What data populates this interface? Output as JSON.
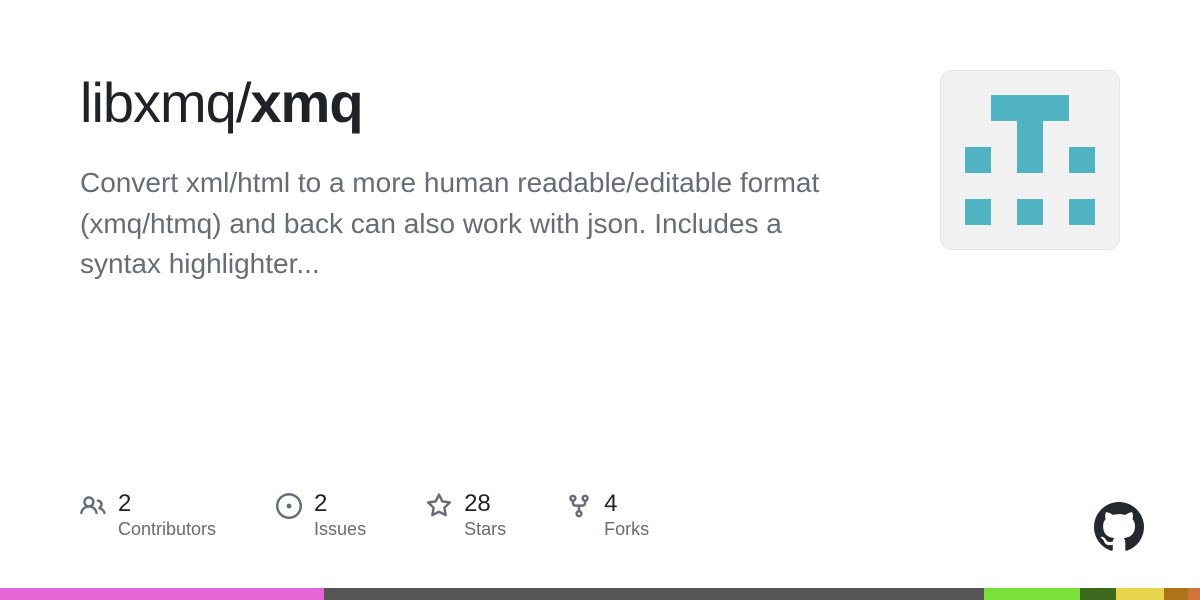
{
  "repo": {
    "owner": "libxmq",
    "name": "xmq",
    "description": "Convert xml/html to a more human readable/editable format (xmq/htmq) and back can also work with json. Includes a syntax highlighter..."
  },
  "stats": {
    "contributors": {
      "value": "2",
      "label": "Contributors"
    },
    "issues": {
      "value": "2",
      "label": "Issues"
    },
    "stars": {
      "value": "28",
      "label": "Stars"
    },
    "forks": {
      "value": "4",
      "label": "Forks"
    }
  },
  "languages": [
    {
      "color": "#e466d6",
      "percent": 27
    },
    {
      "color": "#555555",
      "percent": 55
    },
    {
      "color": "#7ae03a",
      "percent": 8
    },
    {
      "color": "#3c6b1f",
      "percent": 3
    },
    {
      "color": "#e9d54c",
      "percent": 4
    },
    {
      "color": "#b07219",
      "percent": 2
    },
    {
      "color": "#d0743c",
      "percent": 1
    }
  ]
}
